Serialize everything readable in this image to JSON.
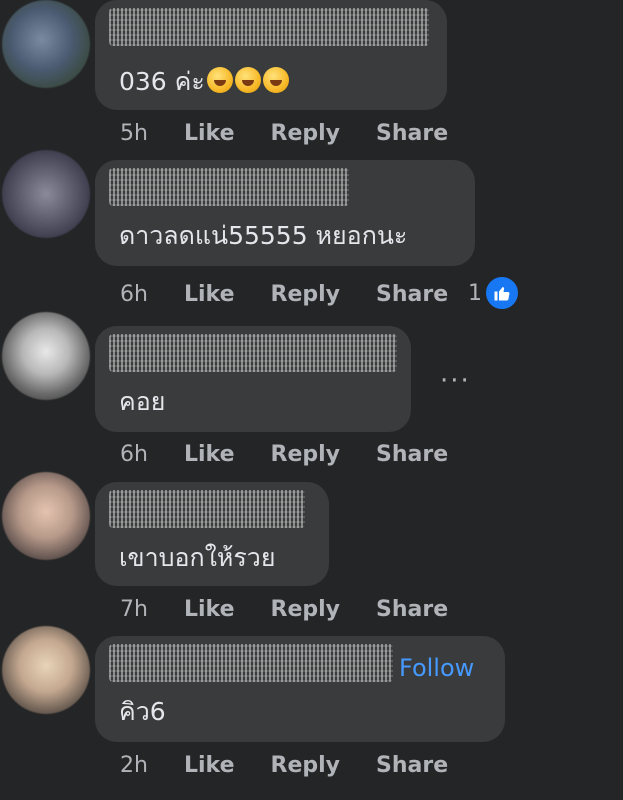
{
  "actions": {
    "like": "Like",
    "reply": "Reply",
    "share": "Share"
  },
  "comments": [
    {
      "text": "036 ค่ะ",
      "time": "5h",
      "emoji_icon": "rolling-on-floor-laughing-icon"
    },
    {
      "text": "ดาวลดแน่55555 หยอกนะ",
      "time": "6h",
      "reaction_count": "1"
    },
    {
      "text": "คอย",
      "time": "6h",
      "more": "···"
    },
    {
      "text": "เขาบอกให้รวย",
      "time": "7h"
    },
    {
      "text": "คิว6",
      "time": "2h",
      "follow": "Follow"
    }
  ],
  "colors": {
    "background": "#242526",
    "bubble": "#3a3b3c",
    "link": "#4599ff",
    "like_blue": "#1877f2"
  }
}
